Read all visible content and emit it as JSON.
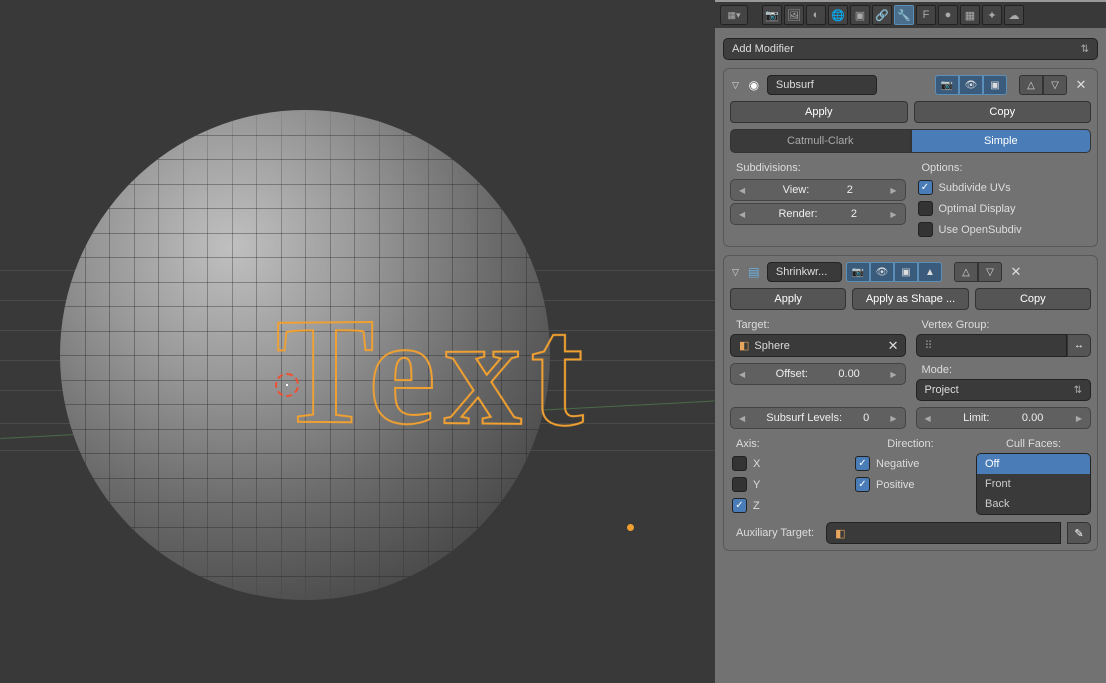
{
  "viewport": {
    "text_object": "Text"
  },
  "header": {
    "tabs": [
      "render",
      "layers",
      "scene",
      "world",
      "object",
      "constraints",
      "modifiers",
      "data",
      "material",
      "texture",
      "particles",
      "physics"
    ]
  },
  "add_modifier": {
    "label": "Add Modifier"
  },
  "subsurf": {
    "name": "Subsurf",
    "apply": "Apply",
    "copy": "Copy",
    "type_a": "Catmull-Clark",
    "type_b": "Simple",
    "subdivisions_label": "Subdivisions:",
    "view_label": "View:",
    "view_value": "2",
    "render_label": "Render:",
    "render_value": "2",
    "options_label": "Options:",
    "opt_subdivide": "Subdivide UVs",
    "opt_optimal": "Optimal Display",
    "opt_osd": "Use OpenSubdiv"
  },
  "shrinkwrap": {
    "name": "Shrinkwr...",
    "apply": "Apply",
    "apply_shape": "Apply as Shape ...",
    "copy": "Copy",
    "target_label": "Target:",
    "target_value": "Sphere",
    "vg_label": "Vertex Group:",
    "offset_label": "Offset:",
    "offset_value": "0.00",
    "mode_label": "Mode:",
    "mode_value": "Project",
    "subsurf_levels_label": "Subsurf Levels:",
    "subsurf_levels_value": "0",
    "limit_label": "Limit:",
    "limit_value": "0.00",
    "axis_label": "Axis:",
    "axis_x": "X",
    "axis_y": "Y",
    "axis_z": "Z",
    "direction_label": "Direction:",
    "dir_negative": "Negative",
    "dir_positive": "Positive",
    "cull_label": "Cull Faces:",
    "cull_off": "Off",
    "cull_front": "Front",
    "cull_back": "Back",
    "aux_label": "Auxiliary Target:"
  }
}
